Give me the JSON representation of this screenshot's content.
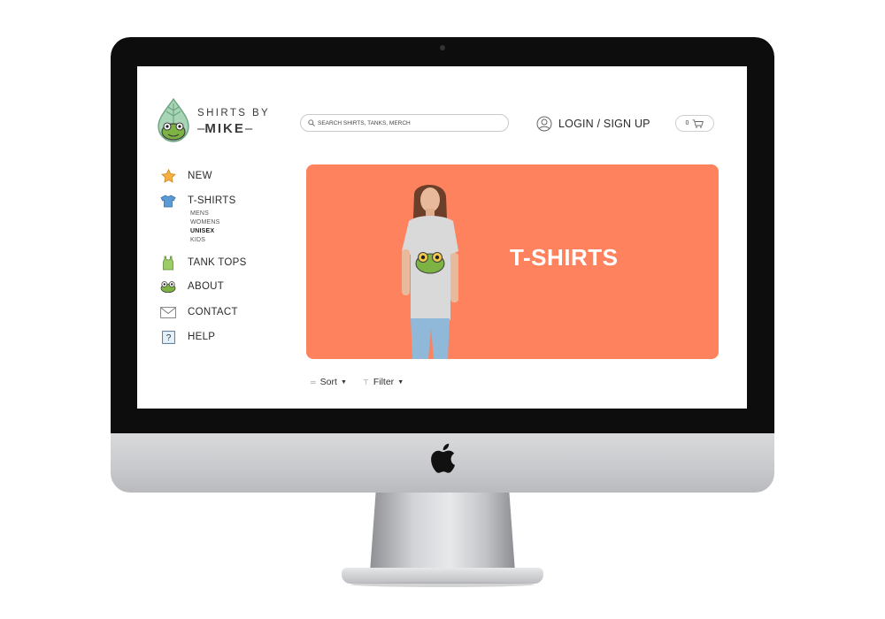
{
  "brand": {
    "line1": "SHIRTS BY",
    "line2": "MIKE"
  },
  "search": {
    "placeholder": "SEARCH SHIRTS, TANKS, MERCH"
  },
  "header": {
    "login_label": "LOGIN / SIGN UP",
    "cart_count": "0"
  },
  "nav": {
    "items": [
      {
        "label": "NEW",
        "icon": "star-icon"
      },
      {
        "label": "T-SHIRTS",
        "icon": "tshirt-icon"
      },
      {
        "label": "TANK TOPS",
        "icon": "tank-top-icon"
      },
      {
        "label": "ABOUT",
        "icon": "frog-icon"
      },
      {
        "label": "CONTACT",
        "icon": "envelope-icon"
      },
      {
        "label": "HELP",
        "icon": "question-box-icon"
      }
    ],
    "tshirt_sub": [
      {
        "label": "MENS",
        "active": false
      },
      {
        "label": "WOMENS",
        "active": false
      },
      {
        "label": "UNISEX",
        "active": true
      },
      {
        "label": "KIDS",
        "active": false
      }
    ]
  },
  "banner": {
    "title": "T-SHIRTS",
    "background": "#fe825d"
  },
  "toolbar": {
    "sort_label": "Sort",
    "filter_label": "Filter"
  },
  "colors": {
    "accent": "#fe825d",
    "frog_green": "#7cb342"
  }
}
